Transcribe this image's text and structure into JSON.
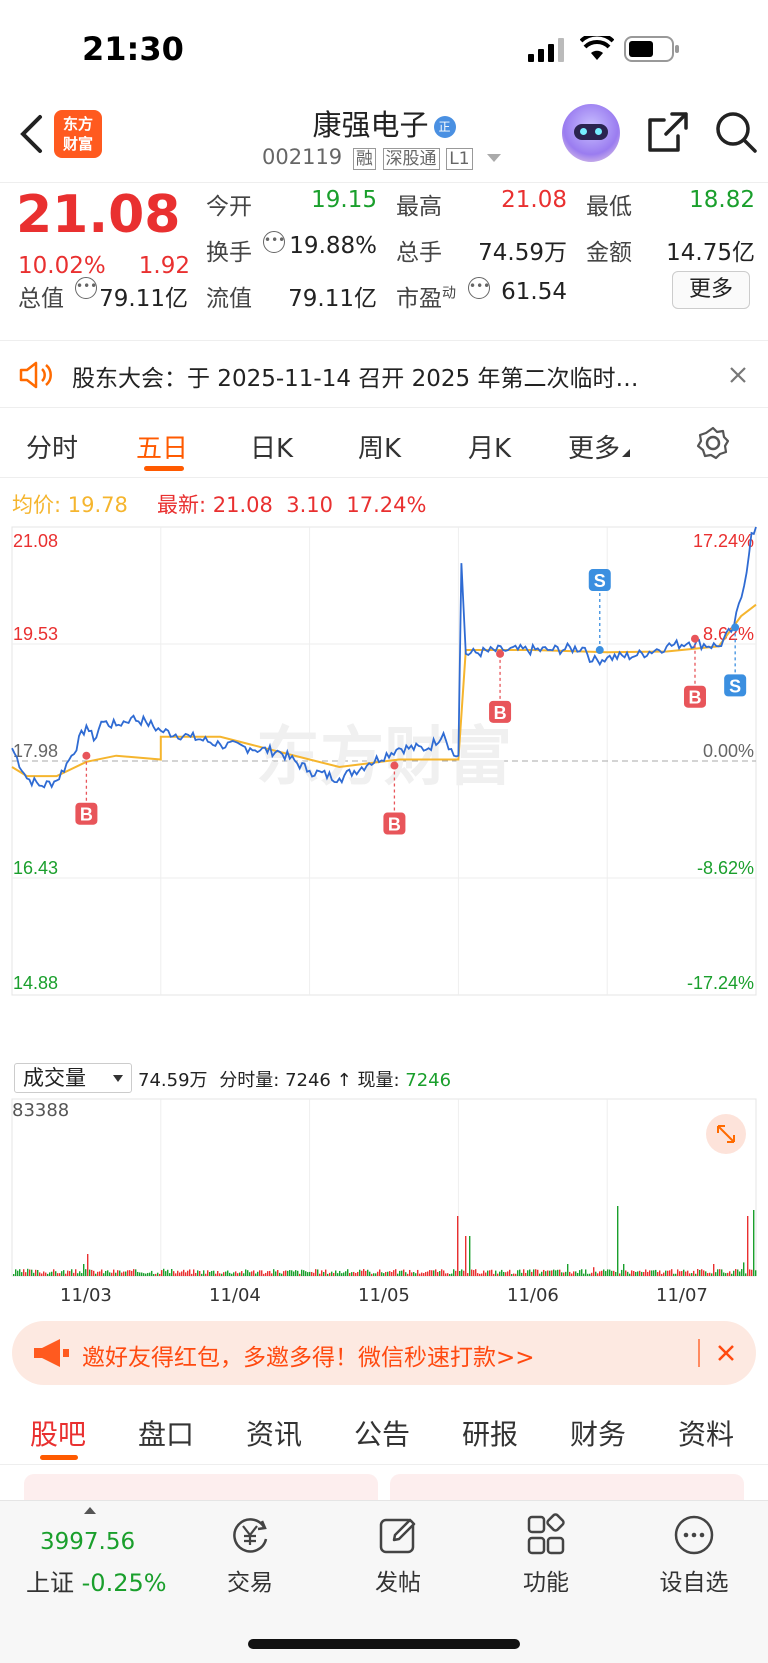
{
  "status_bar": {
    "time": "21:30"
  },
  "header": {
    "title": "康强电子",
    "code": "002119",
    "tags": [
      "融",
      "深股通",
      "L1"
    ],
    "brand": {
      "line1": "东方",
      "line2": "财富"
    }
  },
  "quote": {
    "price": "21.08",
    "change_pct": "10.02%",
    "change": "1.92",
    "fields": {
      "open_label": "今开",
      "open": "19.15",
      "high_label": "最高",
      "high": "21.08",
      "low_label": "最低",
      "low": "18.82",
      "turnover_label": "换手",
      "turnover": "19.88%",
      "volume_label": "总手",
      "volume": "74.59万",
      "amount_label": "金额",
      "amount": "14.75亿",
      "mktcap_label": "总值",
      "mktcap": "79.11亿",
      "float_label": "流值",
      "float": "79.11亿",
      "pe_label": "市盈",
      "pe_sup": "动",
      "pe": "61.54"
    },
    "more_button": "更多"
  },
  "notice": {
    "text": "股东大会：于 2025-11-14 召开 2025 年第二次临时…"
  },
  "chart_tabs": [
    "分时",
    "五日",
    "日K",
    "周K",
    "月K",
    "更多"
  ],
  "active_chart_tab": "五日",
  "legend": {
    "avg_label": "均价:",
    "avg": "19.78",
    "latest_label": "最新:",
    "latest": "21.08",
    "chg": "3.10",
    "chg_pct": "17.24%"
  },
  "chart_data": {
    "type": "line",
    "title": "",
    "y_left_ticks": [
      "21.08",
      "19.53",
      "17.98",
      "16.43",
      "14.88"
    ],
    "y_right_ticks": [
      "17.24%",
      "8.62%",
      "0.00%",
      "-8.62%",
      "-17.24%"
    ],
    "ylim": [
      14.88,
      21.08
    ],
    "x_ticks": [
      "11/03",
      "11/04",
      "11/05",
      "11/06",
      "11/07"
    ],
    "watermark": "东方财富",
    "price_points": [
      [
        0.0,
        18.15
      ],
      [
        0.1,
        17.75
      ],
      [
        0.2,
        17.65
      ],
      [
        0.3,
        17.72
      ],
      [
        0.4,
        18.05
      ],
      [
        0.5,
        18.45
      ],
      [
        0.55,
        18.25
      ],
      [
        0.6,
        18.5
      ],
      [
        0.7,
        18.45
      ],
      [
        0.8,
        18.55
      ],
      [
        0.9,
        18.5
      ],
      [
        1.0,
        18.38
      ],
      [
        1.2,
        18.3
      ],
      [
        1.4,
        18.2
      ],
      [
        1.6,
        18.15
      ],
      [
        1.8,
        18.1
      ],
      [
        2.0,
        17.85
      ],
      [
        2.2,
        17.75
      ],
      [
        2.4,
        17.95
      ],
      [
        2.6,
        18.15
      ],
      [
        2.8,
        18.15
      ],
      [
        2.9,
        18.35
      ],
      [
        2.97,
        18.05
      ],
      [
        3.0,
        18.05
      ],
      [
        3.02,
        20.6
      ],
      [
        3.05,
        19.4
      ],
      [
        3.3,
        19.45
      ],
      [
        3.6,
        19.45
      ],
      [
        3.85,
        19.48
      ],
      [
        3.9,
        19.3
      ],
      [
        4.0,
        19.35
      ],
      [
        4.2,
        19.38
      ],
      [
        4.4,
        19.5
      ],
      [
        4.55,
        19.55
      ],
      [
        4.75,
        19.5
      ],
      [
        4.85,
        19.75
      ],
      [
        4.92,
        20.3
      ],
      [
        4.97,
        21.0
      ],
      [
        5.0,
        21.08
      ]
    ],
    "avg_points": [
      [
        0.0,
        17.9
      ],
      [
        0.1,
        17.78
      ],
      [
        0.3,
        17.78
      ],
      [
        0.5,
        17.97
      ],
      [
        0.7,
        18.05
      ],
      [
        1.0,
        18.0
      ],
      [
        1.0,
        18.3
      ],
      [
        1.2,
        18.3
      ],
      [
        1.4,
        18.3
      ],
      [
        1.6,
        18.2
      ],
      [
        2.0,
        18.0
      ],
      [
        2.2,
        17.9
      ],
      [
        2.4,
        17.95
      ],
      [
        2.6,
        18.0
      ],
      [
        3.0,
        18.0
      ],
      [
        3.05,
        19.45
      ],
      [
        3.5,
        19.45
      ],
      [
        4.0,
        19.42
      ],
      [
        4.4,
        19.43
      ],
      [
        4.75,
        19.5
      ],
      [
        4.9,
        19.9
      ],
      [
        5.0,
        20.05
      ]
    ],
    "markers": [
      {
        "label": "B",
        "t": 0.5,
        "price": 18.05,
        "badge": "below"
      },
      {
        "label": "B",
        "t": 2.57,
        "price": 17.92,
        "badge": "below"
      },
      {
        "label": "B",
        "t": 3.28,
        "price": 19.4,
        "badge": "below"
      },
      {
        "label": "S",
        "t": 3.95,
        "price": 19.45,
        "badge": "above"
      },
      {
        "label": "B",
        "t": 4.59,
        "price": 19.6,
        "badge": "below"
      },
      {
        "label": "S",
        "t": 4.86,
        "price": 19.75,
        "badge": "below"
      }
    ]
  },
  "volume": {
    "selector": "成交量",
    "total": "74.59万",
    "period_label": "分时量:",
    "period": "7246",
    "current_label": "现量:",
    "current": "7246",
    "max_label": "83388"
  },
  "promo": {
    "text": "邀好友得红包，多邀多得！微信秒速打款>>"
  },
  "bottom_tabs": [
    "股吧",
    "盘口",
    "资讯",
    "公告",
    "研报",
    "财务",
    "资料"
  ],
  "active_bottom_tab": "股吧",
  "dock": {
    "index_value": "3997.56",
    "index_name": "上证",
    "index_change": "-0.25%",
    "items": [
      "交易",
      "发帖",
      "功能",
      "设自选"
    ]
  },
  "colors": {
    "up": "#e93030",
    "down": "#1a9f2c",
    "accent": "#ff6a00",
    "price_line": "#2f6bd3",
    "avg_line": "#f5b52e"
  }
}
